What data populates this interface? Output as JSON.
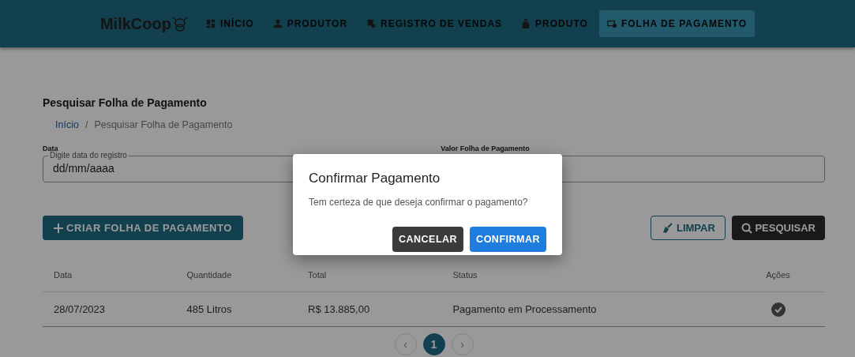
{
  "navbar": {
    "brand": "MilkCoop",
    "items": [
      {
        "label": "INÍCIO",
        "selected": false
      },
      {
        "label": "PRODUTOR",
        "selected": false
      },
      {
        "label": "REGISTRO DE VENDAS",
        "selected": false
      },
      {
        "label": "PRODUTO",
        "selected": false
      },
      {
        "label": "FOLHA DE PAGAMENTO",
        "selected": true
      }
    ]
  },
  "page_title": "Pesquisar Folha de Pagamento",
  "breadcrumb_separator": "/",
  "breadcrumb": [
    {
      "label": "Início",
      "link": true
    },
    {
      "label": "Pesquisar Folha de Pagamento",
      "link": false
    }
  ],
  "fields": [
    {
      "label": "Data",
      "legend": "Digite data do registro",
      "placeholder": "dd/mm/aaaa"
    },
    {
      "label": "Valor Folha de Pagamento"
    }
  ],
  "buttons": {
    "create": "CRIAR FOLHA DE PAGAMENTO",
    "clear": "LIMPAR",
    "search": "PESQUISAR"
  },
  "table": {
    "columns": [
      "Data",
      "Quantidade",
      "Total",
      "Status",
      "Ações"
    ],
    "rows": [
      {
        "cells": [
          "28/07/2023",
          "485 Litros",
          "R$ 13.885,00",
          "Pagamento em Processamento"
        ]
      }
    ]
  },
  "pagination": {
    "prev": "‹",
    "next": "›",
    "pages": [
      {
        "label": "1",
        "selected": true
      }
    ]
  },
  "dialog": {
    "title": "Confirmar Pagamento",
    "message": "Tem certeza de que deseja confirmar o pagamento?",
    "cancel": "CANCELAR",
    "confirm": "CONFIRMAR"
  }
}
